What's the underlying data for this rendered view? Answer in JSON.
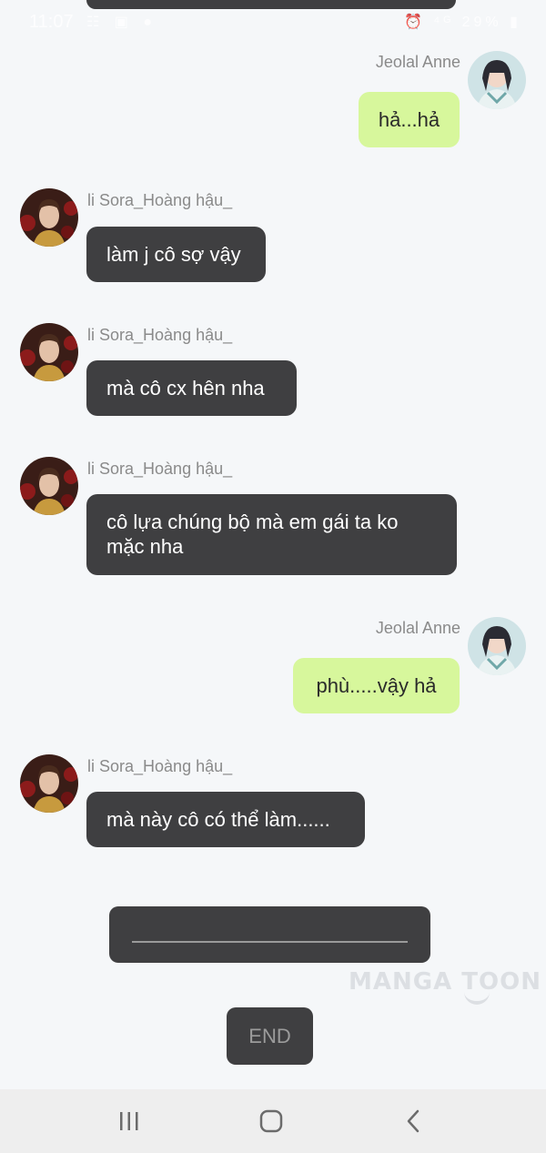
{
  "status_bar": {
    "time": "11:07",
    "left_icons": "☷ ▣ ●",
    "right_icons": "⏰ ⁴ᴳ 29% ▮"
  },
  "messages": [
    {
      "sender": "Jeolal Anne",
      "side": "right",
      "text": "hả...hả"
    },
    {
      "sender": "li Sora_Hoàng hậu_",
      "side": "left",
      "text": "làm j cô sợ vậy"
    },
    {
      "sender": "li Sora_Hoàng hậu_",
      "side": "left",
      "text": "mà cô cx hên nha"
    },
    {
      "sender": "li Sora_Hoàng hậu_",
      "side": "left",
      "text": "cô lựa chúng bộ mà em gái ta ko mặc nha"
    },
    {
      "sender": "Jeolal Anne",
      "side": "right",
      "text": "phù.....vậy hả"
    },
    {
      "sender": "li Sora_Hoàng hậu_",
      "side": "left",
      "text": "mà này cô có thể làm......"
    }
  ],
  "watermark": "MANGA TOON",
  "end_label": "END",
  "nav": {
    "recents_icon": "recents-icon",
    "home_icon": "home-icon",
    "back_icon": "back-icon"
  }
}
